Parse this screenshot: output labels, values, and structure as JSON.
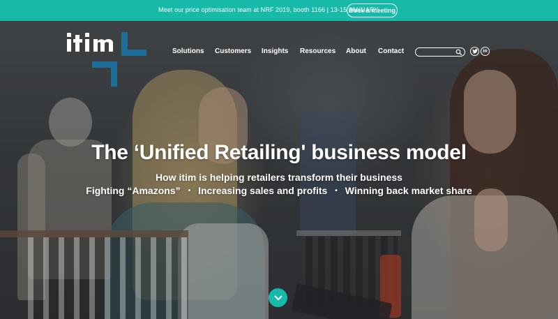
{
  "announcement": {
    "text": "Meet our price optimisation team at NRF 2019, booth 1166 | 13-15 JANUARY",
    "button_label": "Book a meeting"
  },
  "brand": {
    "name": "itim",
    "accent_color": "#17b9a8",
    "mark_color": "#1d6f9a"
  },
  "nav": {
    "items": [
      {
        "label": "Solutions"
      },
      {
        "label": "Customers"
      },
      {
        "label": "Insights"
      },
      {
        "label": "Resources"
      },
      {
        "label": "About"
      },
      {
        "label": "Contact"
      }
    ]
  },
  "search": {
    "placeholder": "",
    "icon": "search-icon"
  },
  "social": [
    {
      "icon": "twitter-icon"
    },
    {
      "icon": "linkedin-icon",
      "glyph": "in"
    }
  ],
  "hero": {
    "headline": "The ‘Unified Retailing' business model",
    "subheadline": "How itim is helping retailers transform their business",
    "points": [
      "Fighting “Amazons”",
      "Increasing sales and profits",
      "Winning back market share"
    ],
    "bullet": "•",
    "scroll_icon": "chevron-down-icon"
  }
}
